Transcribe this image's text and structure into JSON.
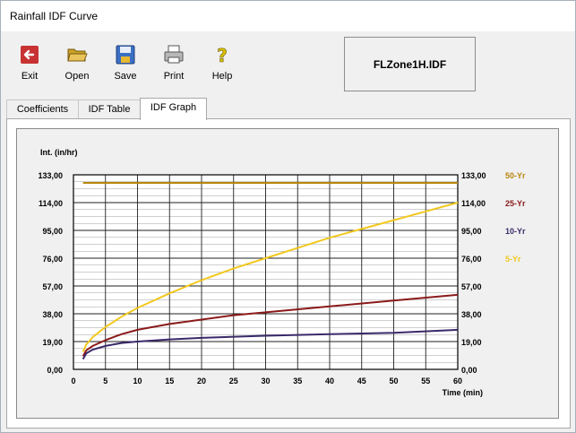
{
  "window": {
    "title": "Rainfall IDF Curve"
  },
  "toolbar": {
    "exit_label": "Exit",
    "open_label": "Open",
    "save_label": "Save",
    "print_label": "Print",
    "help_label": "Help"
  },
  "file": {
    "name": "FLZone1H.IDF"
  },
  "tabs": [
    {
      "label": "Coefficients"
    },
    {
      "label": "IDF Table"
    },
    {
      "label": "IDF Graph",
      "active": true
    }
  ],
  "chart_data": {
    "type": "line",
    "ylabel": "Int. (in/hr)",
    "xlabel": "Time (min)",
    "xlim": [
      0,
      60
    ],
    "ylim": [
      0,
      133
    ],
    "x_ticks": [
      "0",
      "5",
      "10",
      "15",
      "20",
      "25",
      "30",
      "35",
      "40",
      "45",
      "50",
      "55",
      "60"
    ],
    "y_ticks": [
      "0,00",
      "19,00",
      "38,00",
      "57,00",
      "76,00",
      "95,00",
      "114,00",
      "133,00"
    ],
    "grid": true,
    "legend": "right",
    "series": [
      {
        "name": "50-Yr",
        "color": "#b8860b",
        "x": [
          1.5,
          5,
          10,
          20,
          30,
          40,
          50,
          60
        ],
        "y": [
          127.5,
          127.5,
          127.5,
          127.5,
          127.5,
          127.5,
          127.5,
          127.5
        ]
      },
      {
        "name": "25-Yr",
        "color": "#8b1a1a",
        "x": [
          1.5,
          2,
          3,
          5,
          7.5,
          10,
          15,
          20,
          25,
          30,
          40,
          50,
          60
        ],
        "y": [
          9,
          13,
          16,
          20,
          24,
          27,
          31,
          34,
          37,
          39,
          43,
          47,
          51
        ]
      },
      {
        "name": "10-Yr",
        "color": "#3a2a6a",
        "x": [
          1.5,
          2,
          3,
          5,
          7.5,
          10,
          15,
          20,
          30,
          40,
          50,
          60
        ],
        "y": [
          7,
          11,
          13.5,
          16,
          18,
          19,
          20.5,
          21.5,
          23,
          24,
          25,
          27
        ]
      },
      {
        "name": "5-Yr",
        "color": "#f2c81e",
        "x": [
          1.5,
          2,
          3,
          5,
          7.5,
          10,
          15,
          20,
          25,
          30,
          35,
          40,
          45,
          50,
          55,
          60
        ],
        "y": [
          12,
          17,
          22,
          29,
          36,
          42,
          52,
          61,
          69,
          76,
          83,
          90,
          96,
          102,
          108,
          114
        ]
      }
    ]
  }
}
